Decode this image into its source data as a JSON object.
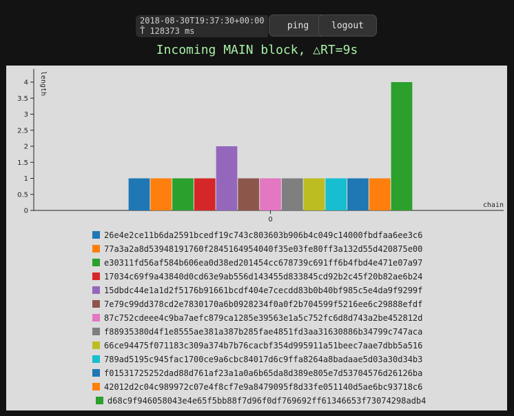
{
  "header": {
    "timestamp": "2018-08-30T19:37:30+00:00",
    "uptime": "T̂ 128373 ms",
    "ping_label": "ping",
    "logout_label": "logout",
    "status": "Incoming MAIN block, △RT=9s"
  },
  "colors": {
    "page_bg": "#131313",
    "panel_bg": "#dcdcdc",
    "status_text": "#a8f0a8"
  },
  "chart_data": {
    "type": "bar",
    "xlabel": "chain",
    "ylabel": "length",
    "categories": [
      "0"
    ],
    "ylim": [
      0,
      4.2
    ],
    "yticks": [
      "0",
      "0.5",
      "1",
      "1.5",
      "2",
      "2.5",
      "3",
      "3.5",
      "4"
    ],
    "grid": false,
    "legend_position": "bottom",
    "series": [
      {
        "name": "26e4e2ce11b6da2591bcedf19c743c803603b906b4c049c14000fbdfaa6ee3c6",
        "value": 1,
        "color": "#1f77b4"
      },
      {
        "name": "77a3a2a8d53948191760f2845164954040f35e03fe80ff3a132d55d420875e00",
        "value": 1,
        "color": "#ff7f0e"
      },
      {
        "name": "e30311fd56af584b606ea0d38ed201454cc678739c691ff6b4fbd4e471e07a97",
        "value": 1,
        "color": "#2ca02c"
      },
      {
        "name": "17034c69f9a43840d0cd63e9ab556d143455d833845cd92b2c45f20b82ae6b24",
        "value": 1,
        "color": "#d62728"
      },
      {
        "name": "15dbdc44e1a1d2f5176b91661bcdf404e7cecdd83b0b40bf985c5e4da9f9299f",
        "value": 2,
        "color": "#9467bd"
      },
      {
        "name": "7e79c99dd378cd2e7830170a6b0928234f0a0f2b704599f5216ee6c29888efdf",
        "value": 1,
        "color": "#8c564b"
      },
      {
        "name": "87c752cdeee4c9ba7aefc879ca1285e39563e1a5c752fc6d8d743a2be452812d",
        "value": 1,
        "color": "#e377c2"
      },
      {
        "name": "f88935380d4f1e8555ae381a387b285fae4851fd3aa31630886b34799c747aca",
        "value": 1,
        "color": "#7f7f7f"
      },
      {
        "name": "66ce94475f071183c309a374b7b76cacbf354d995911a51beec7aae7dbb5a516",
        "value": 1,
        "color": "#bcbd22"
      },
      {
        "name": "789ad5195c945fac1700ce9a6cbc84017d6c9ffa8264a8badaae5d03a30d34b3",
        "value": 1,
        "color": "#17becf"
      },
      {
        "name": "f01531725252dad88d761af23a1a0a6b65da8d389e805e7d53704576d26126ba",
        "value": 1,
        "color": "#1f77b4"
      },
      {
        "name": "42012d2c04c989972c07e4f8cf7e9a8479095f8d33fe051140d5ae6bc93718c6",
        "value": 1,
        "color": "#ff7f0e"
      },
      {
        "name": "d68c9f946058043e4e65f5bb88f7d96f0df769692ff61346653f73074298adb4",
        "value": 4,
        "color": "#2ca02c"
      }
    ]
  }
}
